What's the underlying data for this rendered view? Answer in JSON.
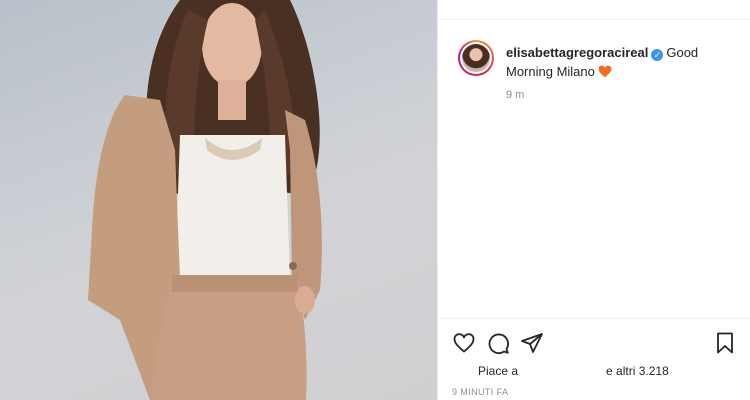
{
  "post": {
    "username": "elisabettagregoracireal",
    "verified_icon": "verified-badge-icon",
    "caption_text": "Good Morning Milano",
    "caption_emoji": "orange-heart-emoji",
    "time_ago": "9 m",
    "likes_prefix": "Piace a",
    "likes_suffix": "e altri 3.218",
    "date_label": "9 MINUTI FA"
  },
  "actions": [
    "like-icon",
    "comment-icon",
    "share-icon",
    "save-icon"
  ],
  "colors": {
    "verified": "#3897f0",
    "heart": "#f26d21",
    "muted_text": "#8e8e8e",
    "primary_text": "#262626"
  }
}
